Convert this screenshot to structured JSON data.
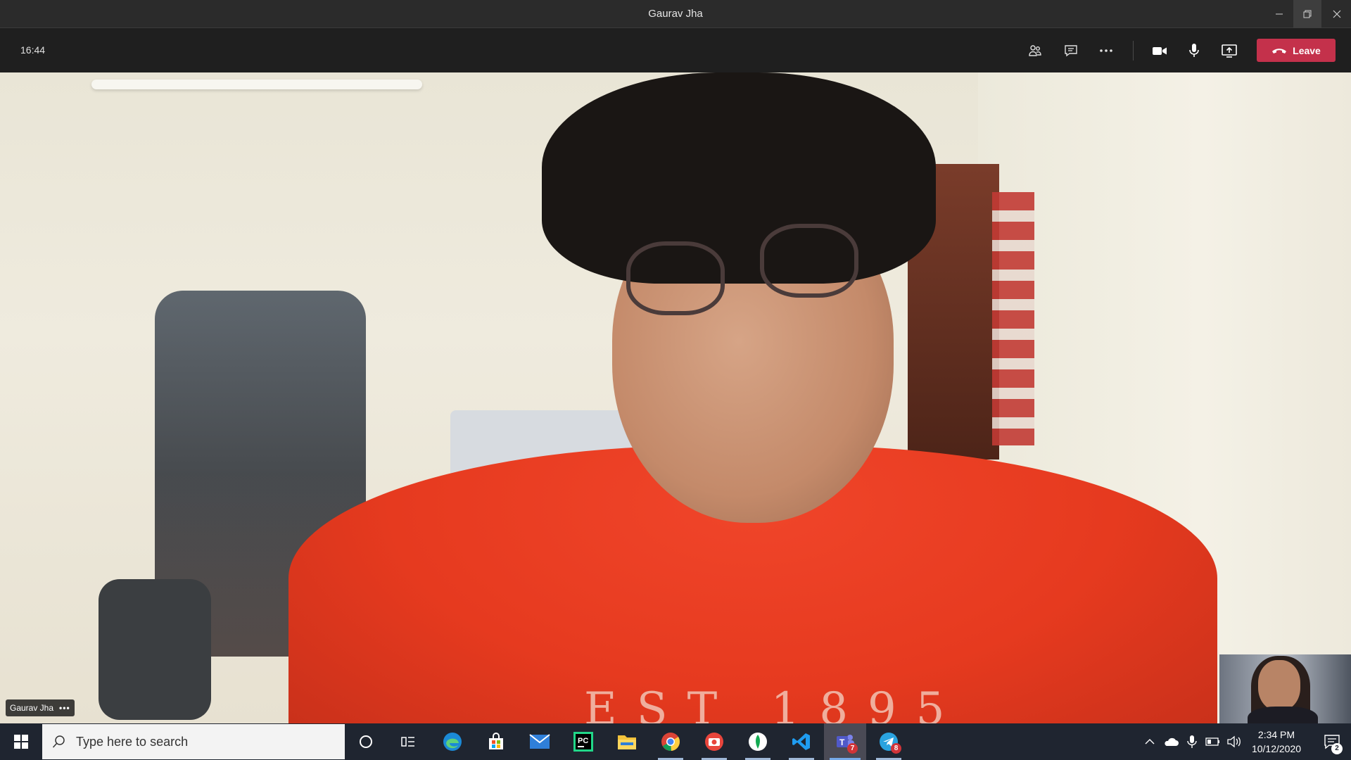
{
  "window": {
    "title": "Gaurav Jha",
    "minimize_glyph": "—",
    "restore_glyph": "❐",
    "close_glyph": "✕"
  },
  "meeting": {
    "timer": "16:44",
    "leave_label": "Leave",
    "icons": [
      "participants-icon",
      "chat-icon",
      "more-options-icon",
      "camera-icon",
      "microphone-icon",
      "share-screen-icon",
      "phone-hangup-icon"
    ]
  },
  "video": {
    "participant_name": "Gaurav Jha",
    "options_glyph": "•••",
    "shirt_print": "EST 1895"
  },
  "taskbar": {
    "search_placeholder": "Type here to search",
    "apps": [
      "cortana",
      "task-view",
      "edge",
      "store",
      "mail",
      "pycharm",
      "file-explorer",
      "chrome",
      "camera",
      "mongodb-compass",
      "vscode",
      "teams",
      "telegram"
    ],
    "teams_badge": "7",
    "telegram_badge": "8",
    "clock_time": "2:34 PM",
    "clock_date": "10/12/2020",
    "notifications_count": "2"
  },
  "colors": {
    "leave": "#c4314b",
    "taskbar": "#1f2530",
    "toolbar": "#1f1f1f"
  }
}
